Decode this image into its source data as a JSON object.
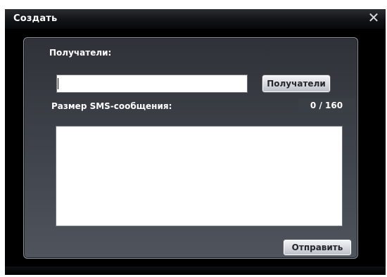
{
  "window": {
    "title": "Создать",
    "close_icon": "close-icon",
    "close_glyph": "✕"
  },
  "form": {
    "recipients_label": "Получатели:",
    "recipients_value": "",
    "recipients_button": "Получатели",
    "sms_size_label": "Размер SMS-сообщения:",
    "char_counter": "0 / 160",
    "message_value": "",
    "send_button": "Отправить"
  }
}
